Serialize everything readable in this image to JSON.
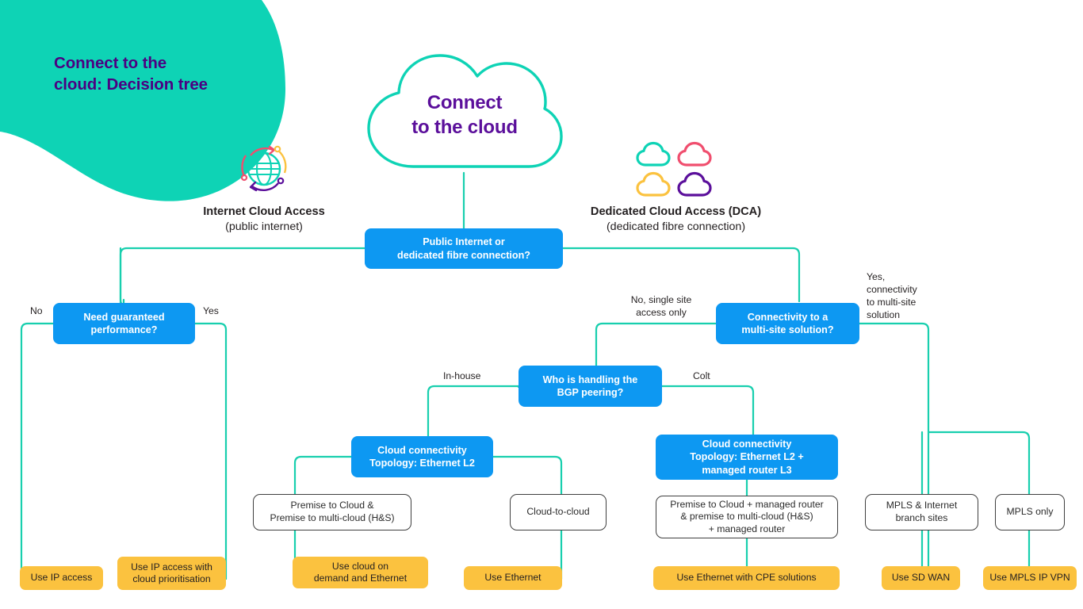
{
  "page": {
    "title_line1": "Connect to the",
    "title_line2": "cloud: Decision tree",
    "background": "#ffffff"
  },
  "colors": {
    "teal": "#0ed3b5",
    "teal_wire": "#18cfae",
    "blue": "#0d98f2",
    "yellow": "#fbc23f",
    "purple": "#5b0f9b",
    "title_purple": "#4B0082",
    "outline_grey": "#3f3f3f",
    "pink": "#f04e6e",
    "gold": "#fbc23f"
  },
  "root": {
    "label_line1": "Connect",
    "label_line2": "to the cloud",
    "icon": "cloud-outline-icon"
  },
  "sections": [
    {
      "id": "internet-cloud-access",
      "title": "Internet Cloud Access",
      "subtitle": "(public internet)",
      "icon": "globe-network-icon"
    },
    {
      "id": "dedicated-cloud-access",
      "title": "Dedicated Cloud Access (DCA)",
      "subtitle": "(dedicated fibre connection)",
      "icon": "four-clouds-icon"
    }
  ],
  "decisions": [
    {
      "id": "public-or-dedicated",
      "line1": "Public Internet or",
      "line2": "dedicated fibre connection?"
    },
    {
      "id": "need-guaranteed-performance",
      "line1": "Need guaranteed",
      "line2": "performance?"
    },
    {
      "id": "multi-site-connectivity",
      "line1": "Connectivity to a",
      "line2": "multi-site solution?"
    },
    {
      "id": "bgp-peering",
      "line1": "Who is handling the",
      "line2": "BGP peering?"
    }
  ],
  "edge_labels": [
    {
      "id": "no-guaranteed",
      "text": "No"
    },
    {
      "id": "yes-guaranteed",
      "text": "Yes"
    },
    {
      "id": "no-single-site",
      "text": "No, single site\naccess only"
    },
    {
      "id": "yes-multi-site",
      "text": "Yes,\nconnectivity\nto multi-site\nsolution"
    },
    {
      "id": "in-house",
      "text": "In-house"
    },
    {
      "id": "colt",
      "text": "Colt"
    }
  ],
  "topologies": [
    {
      "id": "topology-ethernet-l2",
      "line1": "Cloud connectivity",
      "line2": "Topology: Ethernet L2",
      "line3": ""
    },
    {
      "id": "topology-ethernet-l2-l3",
      "line1": "Cloud connectivity",
      "line2": "Topology: Ethernet L2 +",
      "line3": "managed router L3"
    }
  ],
  "scenarios": [
    {
      "id": "premise-to-cloud-hs",
      "line1": "Premise to Cloud &",
      "line2": "Premise to multi-cloud (H&S)",
      "line3": ""
    },
    {
      "id": "cloud-to-cloud",
      "line1": "Cloud-to-cloud",
      "line2": "",
      "line3": ""
    },
    {
      "id": "premise-to-cloud-managed-router",
      "line1": "Premise to Cloud + managed router",
      "line2": "& premise to multi-cloud (H&S)",
      "line3": "+ managed router"
    },
    {
      "id": "mpls-internet-branch-sites",
      "line1": "MPLS & Internet",
      "line2": "branch sites",
      "line3": ""
    },
    {
      "id": "mpls-only",
      "line1": "MPLS only",
      "line2": "",
      "line3": ""
    }
  ],
  "outcomes": [
    {
      "id": "use-ip-access",
      "line1": "Use IP access",
      "line2": ""
    },
    {
      "id": "use-ip-access-cloud-prioritisation",
      "line1": "Use IP access with",
      "line2": "cloud prioritisation"
    },
    {
      "id": "use-cloud-on-demand-ethernet",
      "line1": "Use cloud on",
      "line2": "demand and Ethernet"
    },
    {
      "id": "use-ethernet",
      "line1": "Use Ethernet",
      "line2": ""
    },
    {
      "id": "use-ethernet-cpe",
      "line1": "Use Ethernet with CPE solutions",
      "line2": ""
    },
    {
      "id": "use-sd-wan",
      "line1": "Use SD WAN",
      "line2": ""
    },
    {
      "id": "use-mpls-ip-vpn",
      "line1": "Use MPLS IP VPN",
      "line2": ""
    }
  ]
}
